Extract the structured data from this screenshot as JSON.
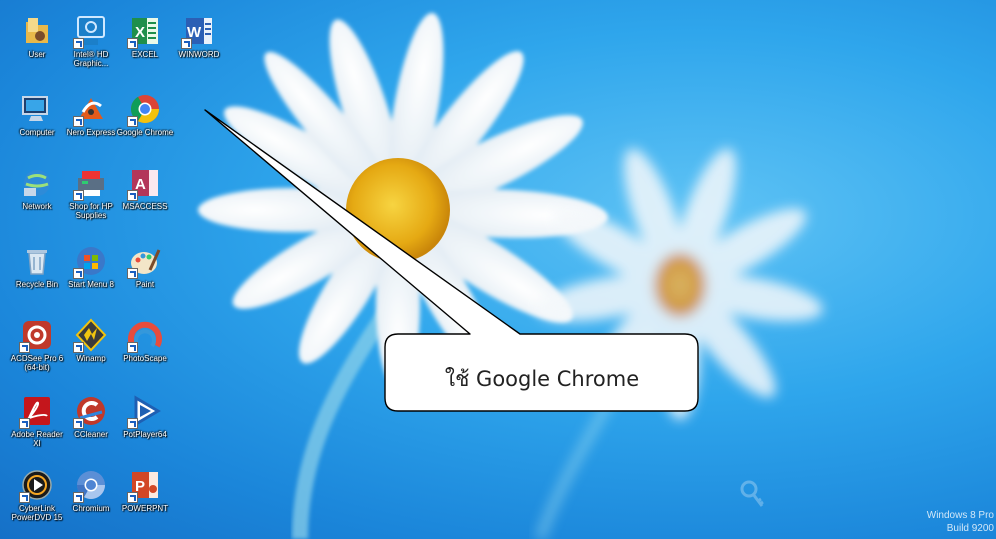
{
  "desktop": {
    "icons": [
      {
        "label": "User",
        "icon": "user-folder-icon"
      },
      {
        "label": "Intel® HD Graphic...",
        "icon": "intel-graphics-icon"
      },
      {
        "label": "EXCEL",
        "icon": "excel-icon"
      },
      {
        "label": "WINWORD",
        "icon": "word-icon"
      },
      {
        "label": "Computer",
        "icon": "computer-icon"
      },
      {
        "label": "Nero Express",
        "icon": "nero-express-icon"
      },
      {
        "label": "Google Chrome",
        "icon": "chrome-icon"
      },
      {
        "label": "Network",
        "icon": "network-icon"
      },
      {
        "label": "Shop for HP Supplies",
        "icon": "hp-supplies-icon"
      },
      {
        "label": "MSACCESS",
        "icon": "access-icon"
      },
      {
        "label": "Recycle Bin",
        "icon": "recycle-bin-icon"
      },
      {
        "label": "Start Menu 8",
        "icon": "start-menu-icon"
      },
      {
        "label": "Paint",
        "icon": "paint-icon"
      },
      {
        "label": "ACDSee Pro 6 (64-bit)",
        "icon": "acdsee-icon"
      },
      {
        "label": "Winamp",
        "icon": "winamp-icon"
      },
      {
        "label": "PhotoScape",
        "icon": "photoscape-icon"
      },
      {
        "label": "Adobe Reader XI",
        "icon": "adobe-reader-icon"
      },
      {
        "label": "CCleaner",
        "icon": "ccleaner-icon"
      },
      {
        "label": "PotPlayer64",
        "icon": "potplayer-icon"
      },
      {
        "label": "CyberLink PowerDVD 15",
        "icon": "powerdvd-icon"
      },
      {
        "label": "Chromium",
        "icon": "chromium-icon"
      },
      {
        "label": "POWERPNT",
        "icon": "powerpoint-icon"
      }
    ]
  },
  "callout": {
    "text": "ใช้ Google Chrome"
  },
  "watermark": {
    "line1": "Windows 8 Pro",
    "line2": "Build 9200"
  },
  "colors": {
    "sky": "#2fa6ec",
    "callout_fill": "#ffffff",
    "callout_stroke": "#000000"
  }
}
